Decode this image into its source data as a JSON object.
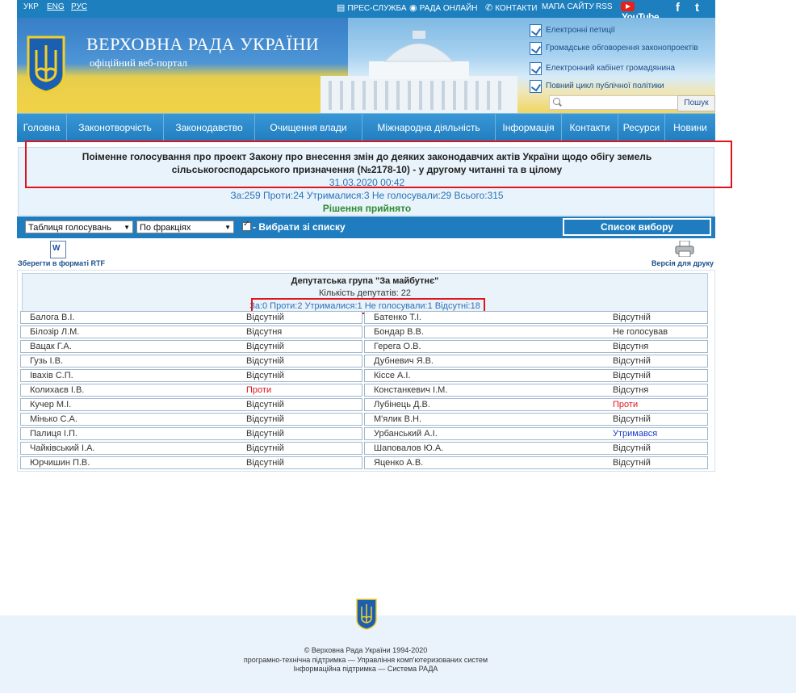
{
  "topbar": {
    "languages": [
      "УКР",
      "ENG",
      "РУС"
    ],
    "links": [
      "ПРЕС-СЛУЖБА",
      "РАДА ОНЛАЙН",
      "КОНТАКТИ",
      "МАПА САЙТУ",
      "RSS"
    ],
    "youtube": "YouTube",
    "facebook": "f",
    "twitter": "t"
  },
  "header": {
    "title": "ВЕРХОВНА РАДА УКРАЇНИ",
    "subtitle": "офіційний веб-портал",
    "quick_links": [
      "Електронні петиції",
      "Громадське обговорення законопроектів",
      "Електронний кабінет громадянина",
      "Повний цикл публічної політики"
    ],
    "search_placeholder": "",
    "search_button": "Пошук"
  },
  "nav": [
    "Головна",
    "Законотворчість",
    "Законодавство",
    "Очищення влади",
    "Міжнародна діяльність",
    "Інформація",
    "Контакти",
    "Ресурси",
    "Новини"
  ],
  "vote": {
    "title": "Поіменне голосування про проект Закону про внесення змін до деяких законодавчих актів України щодо обігу земель сільськогосподарського призначення (№2178-10) - у другому читанні та в цілому",
    "datetime": "31.03.2020 00:42",
    "summary": "За:259 Проти:24 Утрималися:3 Не голосували:29 Всього:315",
    "result": "Рішення прийнято"
  },
  "controls": {
    "table_select": "Таблиця голосувань",
    "faction_select": "По фракціях",
    "select_from_list": "- Вибрати зі списку",
    "selection_list_button": "Список вибору",
    "save_rtf": "Зберегти в форматі RTF",
    "print_version": "Версія для друку"
  },
  "faction": {
    "name": "Депутатська група \"За майбутнє\"",
    "count": "Кількість депутатів: 22",
    "summary": "За:0 Проти:2 Утрималися:1 Не голосували:1 Відсутні:18"
  },
  "deputies": [
    {
      "left_name": "Балога В.І.",
      "left_vote": "Відсутній",
      "left_kind": "absent",
      "right_name": "Батенко Т.І.",
      "right_vote": "Відсутній",
      "right_kind": "absent"
    },
    {
      "left_name": "Білозір Л.М.",
      "left_vote": "Відсутня",
      "left_kind": "absent",
      "right_name": "Бондар В.В.",
      "right_vote": "Не голосував",
      "right_kind": "nv"
    },
    {
      "left_name": "Вацак Г.А.",
      "left_vote": "Відсутній",
      "left_kind": "absent",
      "right_name": "Герега О.В.",
      "right_vote": "Відсутня",
      "right_kind": "absent"
    },
    {
      "left_name": "Гузь І.В.",
      "left_vote": "Відсутній",
      "left_kind": "absent",
      "right_name": "Дубневич Я.В.",
      "right_vote": "Відсутній",
      "right_kind": "absent"
    },
    {
      "left_name": "Іваxів С.П.",
      "left_vote": "Відсутній",
      "left_kind": "absent",
      "right_name": "Кіссе А.І.",
      "right_vote": "Відсутній",
      "right_kind": "absent"
    },
    {
      "left_name": "Колихаєв І.В.",
      "left_vote": "Проти",
      "left_kind": "against",
      "right_name": "Констанкевич І.М.",
      "right_vote": "Відсутня",
      "right_kind": "absent"
    },
    {
      "left_name": "Кучер М.І.",
      "left_vote": "Відсутній",
      "left_kind": "absent",
      "right_name": "Лубінець Д.В.",
      "right_vote": "Проти",
      "right_kind": "against"
    },
    {
      "left_name": "Мінько С.А.",
      "left_vote": "Відсутній",
      "left_kind": "absent",
      "right_name": "М'ялик В.Н.",
      "right_vote": "Відсутній",
      "right_kind": "absent"
    },
    {
      "left_name": "Палиця І.П.",
      "left_vote": "Відсутній",
      "left_kind": "absent",
      "right_name": "Урбанський А.І.",
      "right_vote": "Утримався",
      "right_kind": "abstain"
    },
    {
      "left_name": "Чайківський І.А.",
      "left_vote": "Відсутній",
      "left_kind": "absent",
      "right_name": "Шаповалов Ю.А.",
      "right_vote": "Відсутній",
      "right_kind": "absent"
    },
    {
      "left_name": "Юрчишин П.В.",
      "left_vote": "Відсутній",
      "left_kind": "absent",
      "right_name": "Яценко А.В.",
      "right_vote": "Відсутній",
      "right_kind": "absent"
    }
  ],
  "footer": {
    "copyright": "© Верховна Рада України 1994-2020",
    "tech_support": "програмно-технічна підтримка — Управління комп'ютеризованих систем",
    "info_support": "Інформаційна підтримка — Система РАДА"
  },
  "colors": {
    "primary_blue": "#1f7dbf",
    "highlight_red": "#e0141d",
    "against_red": "#e0141d",
    "abstain_blue": "#1a3cc9",
    "accepted_green": "#2e8b2e"
  },
  "icons": {
    "press": "press-icon",
    "online": "broadcast-icon",
    "contacts": "phone-icon",
    "word": "word-document-icon",
    "printer": "printer-icon",
    "search": "search-icon",
    "emblem": "trident-icon"
  }
}
